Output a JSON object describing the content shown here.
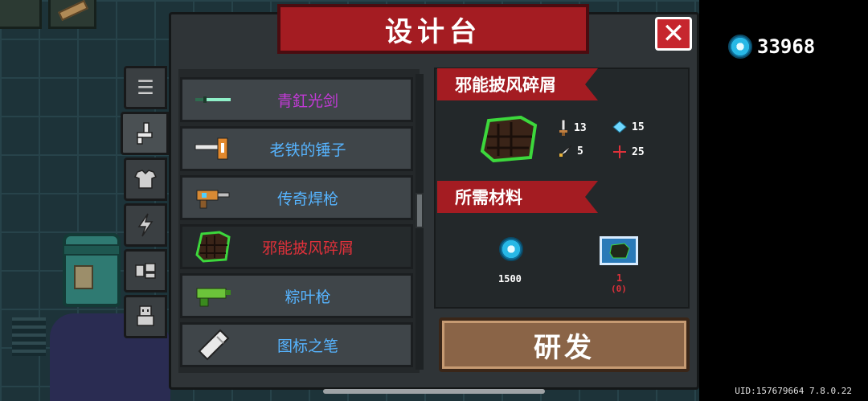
{
  "window": {
    "title": "设计台",
    "close_label": "✕"
  },
  "currency": {
    "icon": "gem-icon",
    "value": "33968"
  },
  "uid": "UID:157679664 7.8.0.22",
  "tabs": [
    {
      "name": "list",
      "icon": "☰"
    },
    {
      "name": "weapon",
      "icon": "⚒"
    },
    {
      "name": "armor",
      "icon": "👕"
    },
    {
      "name": "skill",
      "icon": "⚡"
    },
    {
      "name": "pet",
      "icon": "🐾"
    },
    {
      "name": "character",
      "icon": "☺"
    }
  ],
  "items": [
    {
      "name": "青釭光剑",
      "color": "#c23ad6",
      "icon": "sword-icon",
      "selected": false
    },
    {
      "name": "老铁的锤子",
      "color": "#56b4ff",
      "icon": "hammer-icon",
      "selected": false
    },
    {
      "name": "传奇焊枪",
      "color": "#56b4ff",
      "icon": "welder-icon",
      "selected": false
    },
    {
      "name": "邪能披风碎屑",
      "color": "#e0313a",
      "icon": "cloak-icon",
      "selected": true
    },
    {
      "name": "粽叶枪",
      "color": "#56b4ff",
      "icon": "leaf-gun-icon",
      "selected": false
    },
    {
      "name": "图标之笔",
      "color": "#56b4ff",
      "icon": "pen-icon",
      "selected": false
    }
  ],
  "detail": {
    "item_name": "邪能披风碎屑",
    "stats": {
      "attack": "13",
      "energy": "15",
      "crit": "5",
      "accuracy": "25"
    },
    "materials_title": "所需材料",
    "materials": [
      {
        "icon": "gem-icon",
        "value": "1500",
        "color": "#ffffff"
      },
      {
        "icon": "blueprint-icon",
        "value": "1",
        "sub": "(0)",
        "color": "#e0313a"
      }
    ]
  },
  "research_button": "研发"
}
